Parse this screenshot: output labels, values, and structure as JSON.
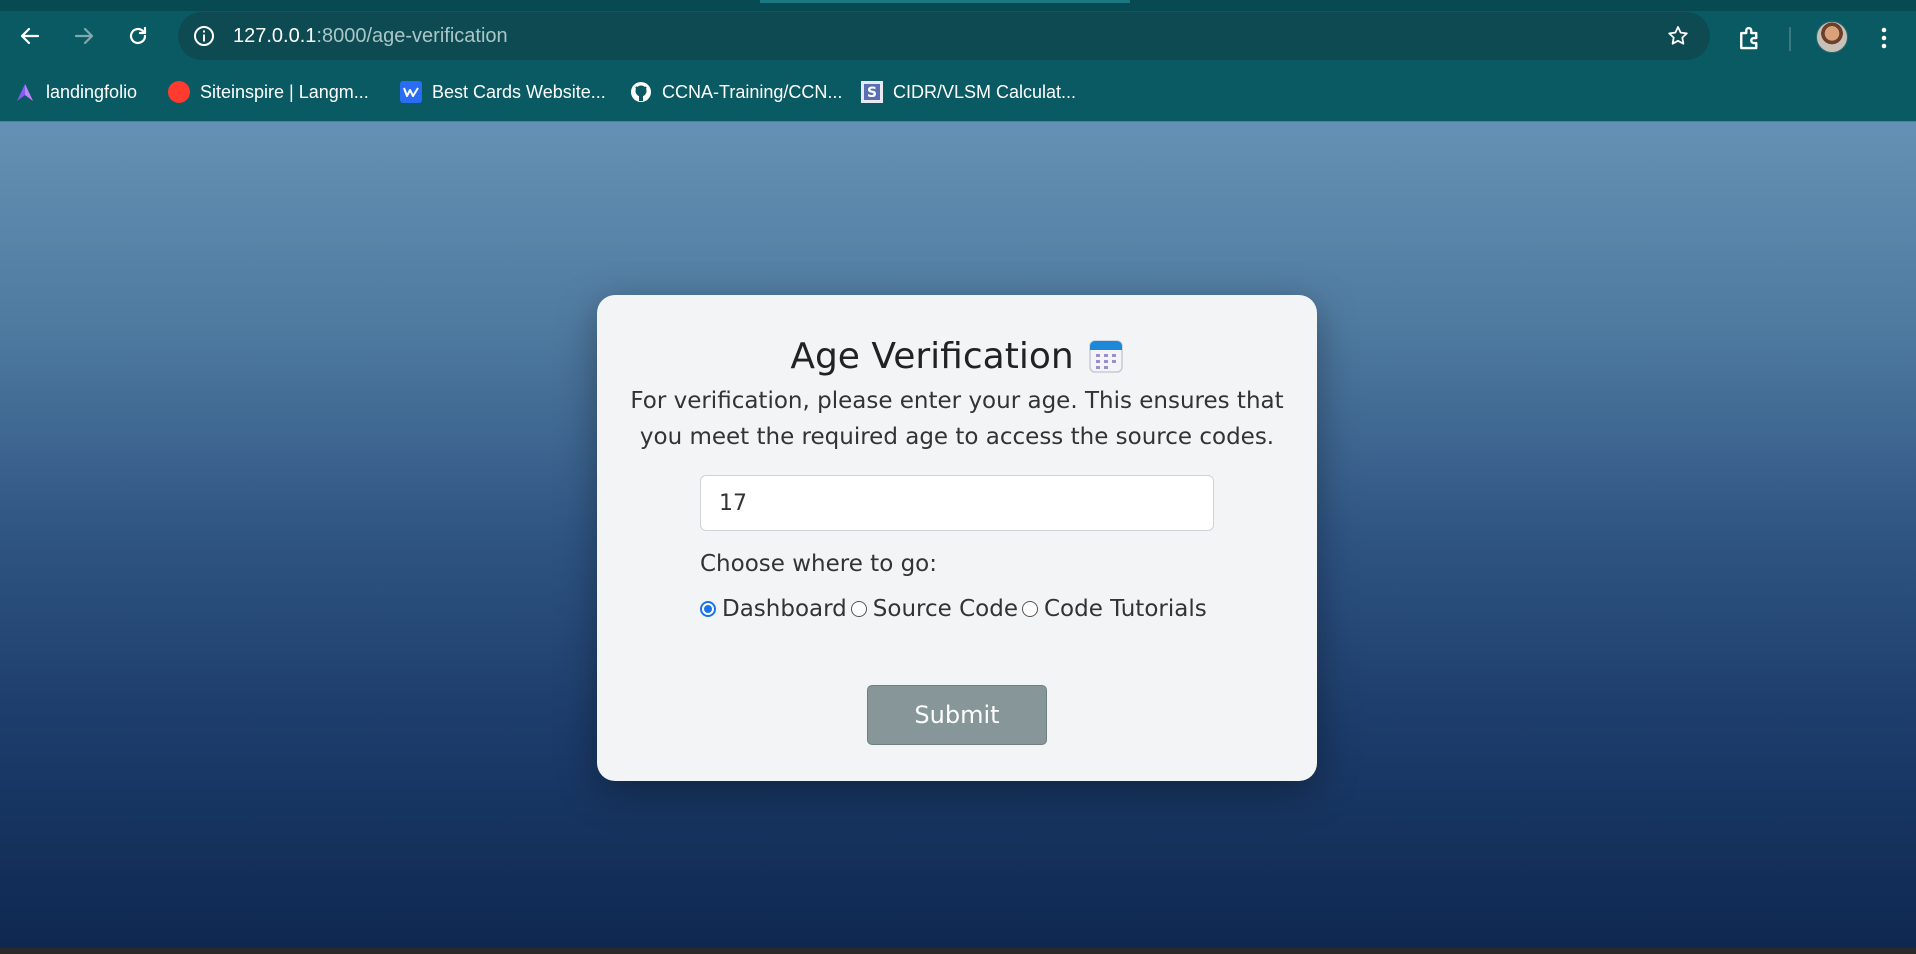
{
  "browser": {
    "url_host": "127.0.0.1",
    "url_path": ":8000/age-verification",
    "bookmarks": [
      {
        "label": "landingfolio",
        "icon": "landingfolio-icon"
      },
      {
        "label": "Siteinspire | Langm...",
        "icon": "siteinspire-icon"
      },
      {
        "label": "Best Cards Website...",
        "icon": "webflow-icon"
      },
      {
        "label": "CCNA-Training/CCN...",
        "icon": "github-icon"
      },
      {
        "label": "CIDR/VLSM Calculat...",
        "icon": "calculator-icon"
      }
    ]
  },
  "card": {
    "title": "Age Verification",
    "title_icon": "calendar-icon",
    "description": "For verification, please enter your age. This ensures that you meet the required age to access the source codes.",
    "age_value": "17",
    "choose_label": "Choose where to go:",
    "options": [
      {
        "label": "Dashboard",
        "checked": true
      },
      {
        "label": "Source Code",
        "checked": false
      },
      {
        "label": "Code Tutorials",
        "checked": false
      }
    ],
    "submit_label": "Submit"
  },
  "colors": {
    "chrome": "#0a5a63",
    "radio_accent": "#1a73e8",
    "submit_bg": "#879799"
  }
}
